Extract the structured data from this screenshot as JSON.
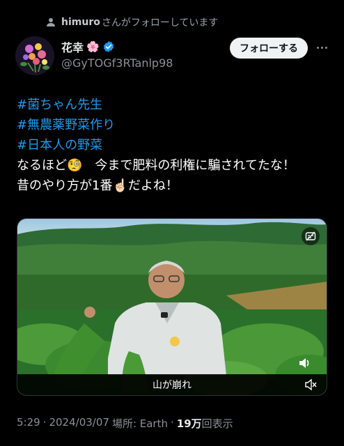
{
  "social_context": {
    "name": "himuro",
    "suffix": "さんがフォローしています"
  },
  "author": {
    "display_name": "花幸",
    "emoji": "🌸",
    "handle": "@GyTOGf3RTanlp98"
  },
  "follow_button": {
    "label": "フォローする"
  },
  "post": {
    "hashtags": [
      "#菌ちゃん先生",
      "#無農薬野菜作り",
      "#日本人の野菜"
    ],
    "line1": " なるほど🧐　今まで肥料の利権に騙されてたな！",
    "line2": "昔のやり方が1番☝🏻だよね！"
  },
  "video": {
    "subtitle": "山が崩れ"
  },
  "meta": {
    "time": "5:29",
    "dot1": "·",
    "date": "2024/03/07",
    "location_label": "場所: Earth",
    "dot2": "·",
    "views_count": "19万",
    "views_suffix": "回表示"
  },
  "colors": {
    "accent": "#1d9bf0",
    "verified": "#1d9bf0",
    "background": "#000000"
  }
}
